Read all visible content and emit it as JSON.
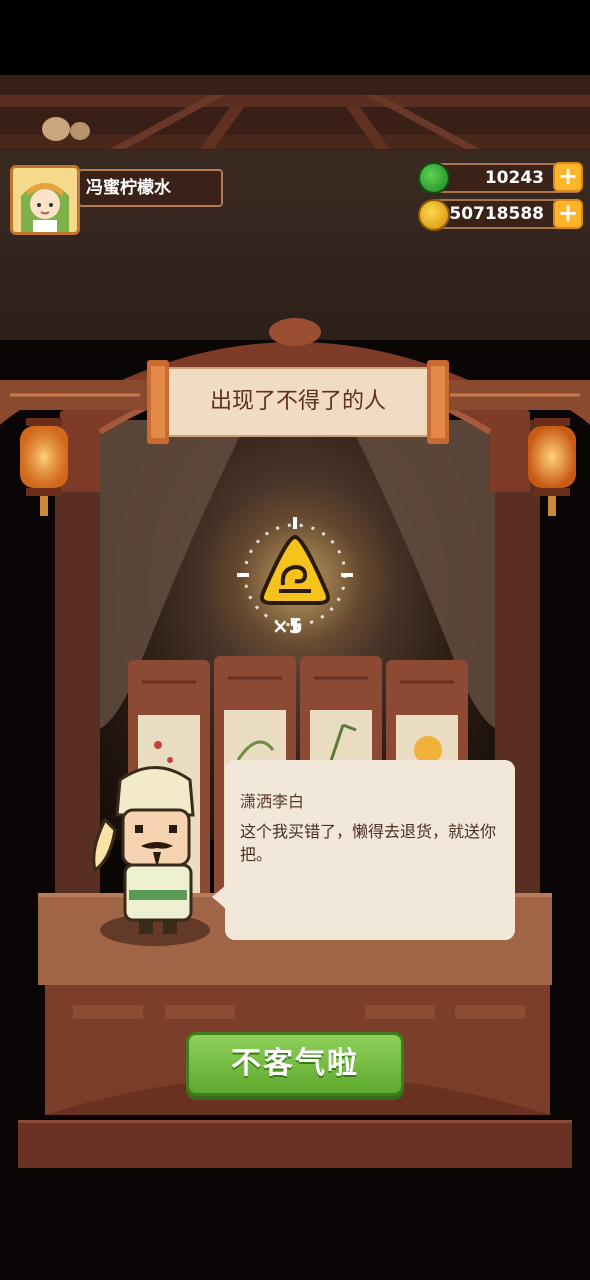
{
  "player": {
    "name": "冯蜜柠檬水"
  },
  "currency": {
    "jade": "10243",
    "coins": "50718588"
  },
  "event": {
    "title": "出现了不得了的人",
    "reward_count": "×5",
    "speaker": "潇洒李白",
    "dialog": "这个我买错了，懒得去退货，就送你把。",
    "confirm_label": "不客气啦"
  },
  "colors": {
    "accent_green": "#5ea92e",
    "gold": "#ffb42a",
    "wood": "#7b3e2a"
  },
  "icons": [
    "jade-icon",
    "coin-icon",
    "plus-icon",
    "golden-bell-icon",
    "lantern-icon"
  ]
}
